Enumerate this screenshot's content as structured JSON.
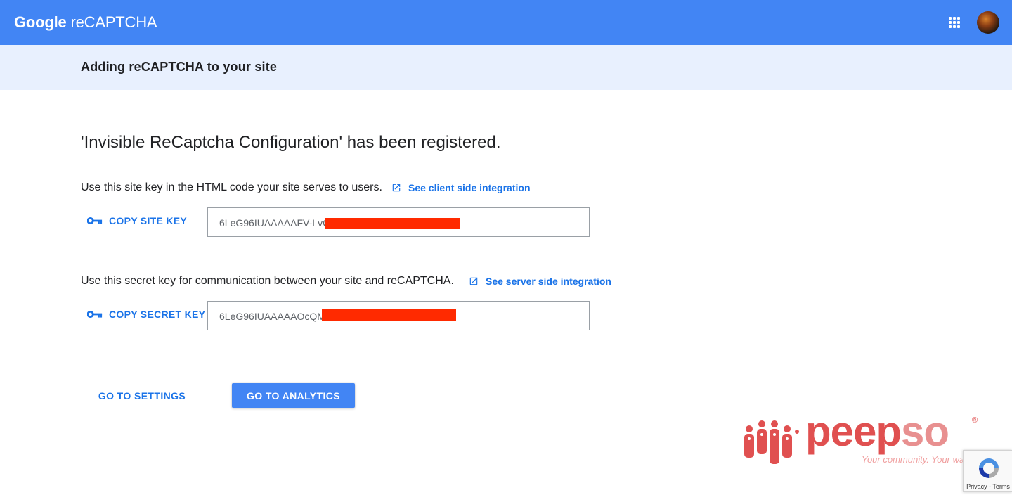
{
  "header": {
    "brand_google": "Google",
    "brand_product": "reCAPTCHA",
    "apps_icon": "apps-grid-icon",
    "avatar": "user-avatar"
  },
  "subheader": {
    "title": "Adding reCAPTCHA to your site"
  },
  "main": {
    "heading": "'Invisible ReCaptcha Configuration' has been registered.",
    "site_key": {
      "description": "Use this site key in the HTML code your site serves to users.",
      "link_label": "See client side integration",
      "copy_label": "COPY SITE KEY",
      "value": "6LeG96IUAAAAAFV-LvC"
    },
    "secret_key": {
      "description": "Use this secret key for communication between your site and reCAPTCHA.",
      "link_label": "See server side integration",
      "copy_label": "COPY SECRET KEY",
      "value": "6LeG96IUAAAAAOcQM"
    },
    "actions": {
      "settings_label": "GO TO SETTINGS",
      "analytics_label": "GO TO ANALYTICS"
    }
  },
  "watermark": {
    "word_main": "peep",
    "word_accent": "so",
    "registered": "®",
    "tagline": "Your community. Your way."
  },
  "recaptcha_badge": {
    "links": "Privacy - Terms"
  },
  "colors": {
    "topbar": "#4285f4",
    "subheader": "#e8f0fe",
    "link": "#1a73e8",
    "redaction": "#ff2a00"
  }
}
